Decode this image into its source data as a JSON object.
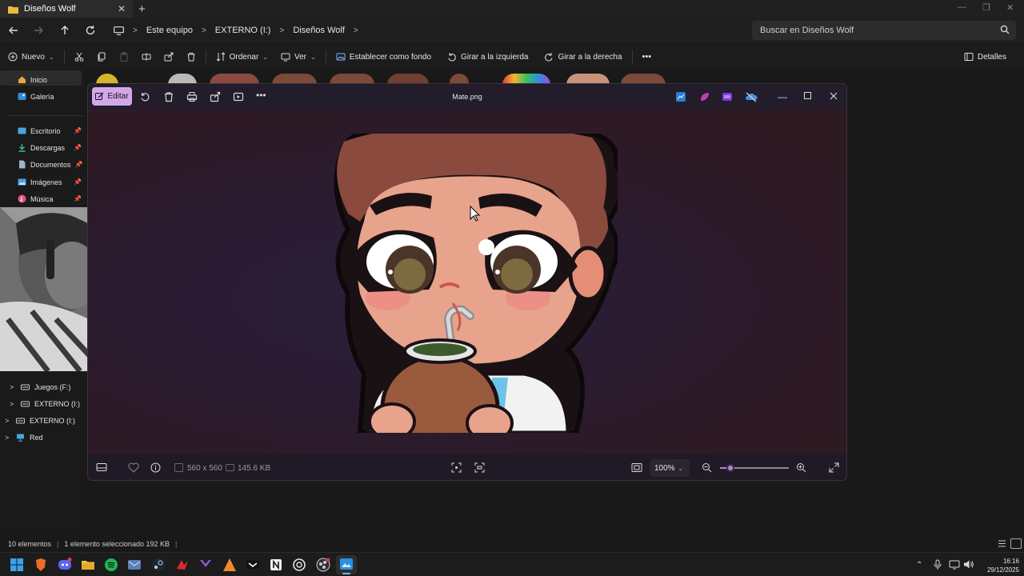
{
  "window": {
    "tab_title": "Diseños Wolf",
    "new_tab": "+",
    "close": "✕"
  },
  "nav": {
    "breadcrumb": [
      "Este equipo",
      "EXTERNO (I:)",
      "Diseños Wolf"
    ],
    "search_placeholder": "Buscar en Diseños Wolf"
  },
  "toolbar": {
    "new_label": "Nuevo",
    "sort_label": "Ordenar",
    "view_label": "Ver",
    "set_background": "Establecer como fondo",
    "rotate_left": "Girar a la izquierda",
    "rotate_right": "Girar a la derecha",
    "more": "•••",
    "details": "Detalles"
  },
  "sidebar": {
    "home": "Inicio",
    "gallery": "Galería",
    "quick": [
      {
        "label": "Escritorio",
        "color": "#4aa3e0"
      },
      {
        "label": "Descargas",
        "color": "#3fbf7f"
      },
      {
        "label": "Documentos",
        "color": "#9fb4c8"
      },
      {
        "label": "Imágenes",
        "color": "#4aa3e0"
      },
      {
        "label": "Música",
        "color": "#e2568b"
      }
    ],
    "tree": [
      {
        "label": "Juegos (F:)"
      },
      {
        "label": "EXTERNO (I:)"
      },
      {
        "label": "EXTERNO (I:)"
      },
      {
        "label": "Red"
      }
    ]
  },
  "viewer": {
    "edit_label": "Editar",
    "file_title": "Mate.png",
    "dimensions": "560 x 560",
    "file_size": "145.6 KB",
    "zoom": "100%",
    "zoom_fraction": 0.15,
    "accent": "#d3a8e6"
  },
  "status": {
    "count": "10 elementos",
    "selection": "1 elemento seleccionado  192 KB"
  },
  "clock": {
    "time": "16:16",
    "date": "29/12/2025"
  }
}
